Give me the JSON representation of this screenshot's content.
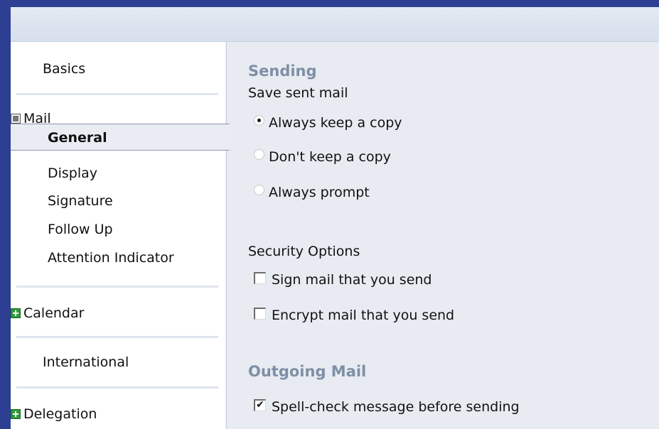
{
  "nav": {
    "basics": "Basics",
    "mail": {
      "label": "Mail",
      "expanded": true,
      "children": [
        "General",
        "Display",
        "Signature",
        "Follow Up",
        "Attention Indicator"
      ],
      "selected": "General"
    },
    "calendar": {
      "label": "Calendar",
      "expanded": false
    },
    "international": "International",
    "delegation": {
      "label": "Delegation",
      "expanded": false
    }
  },
  "sending": {
    "title": "Sending",
    "save_sent_label": "Save sent mail",
    "radios": [
      {
        "label": "Always keep a copy",
        "checked": true
      },
      {
        "label": "Don't keep a copy",
        "checked": false
      },
      {
        "label": "Always prompt",
        "checked": false
      }
    ],
    "security_label": "Security Options",
    "security_checks": [
      {
        "label": "Sign mail that you send",
        "checked": false
      },
      {
        "label": "Encrypt mail that you send",
        "checked": false
      }
    ]
  },
  "outgoing": {
    "title": "Outgoing Mail",
    "spellcheck": {
      "label": "Spell-check message before sending",
      "checked": true
    }
  },
  "icons": {
    "expanded_tree": "minus-box-icon",
    "collapsed_tree": "plus-box-icon",
    "checkmark": "✔"
  },
  "colors": {
    "frame_bg": "#2d3f93",
    "section_title": "#7e8fa6",
    "plus_green": "#2e9b3a"
  }
}
